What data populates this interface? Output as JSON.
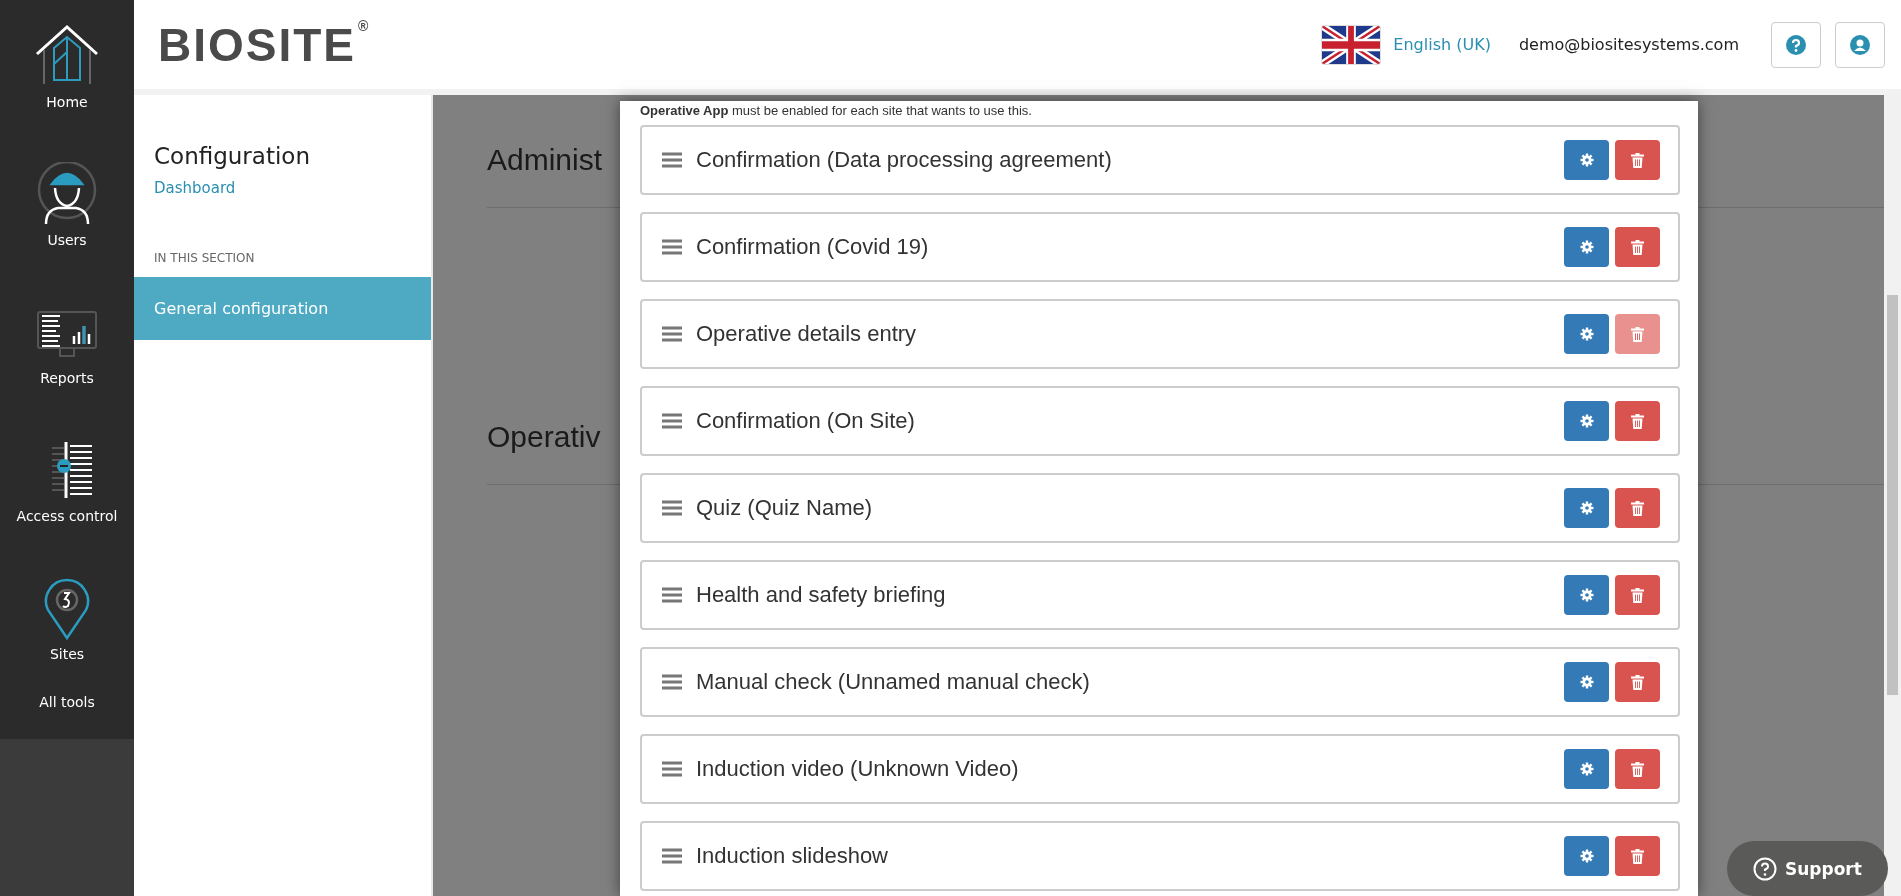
{
  "nav": {
    "items": [
      {
        "label": "Home"
      },
      {
        "label": "Users"
      },
      {
        "label": "Reports"
      },
      {
        "label": "Access control"
      },
      {
        "label": "Sites"
      }
    ],
    "all_tools": "All tools"
  },
  "header": {
    "logo": "BIOSITE",
    "logo_mark": "®",
    "language": "English (UK)",
    "email": "demo@biositesystems.com"
  },
  "sidebar": {
    "title": "Configuration",
    "link": "Dashboard",
    "section_label": "IN THIS SECTION",
    "items": [
      {
        "label": "General configuration",
        "selected": true
      }
    ]
  },
  "background": {
    "headings": [
      "Administ",
      "Operativ"
    ]
  },
  "modal": {
    "note": "**Operative App** must be enabled for each site that wants to use this.",
    "steps": [
      {
        "label": "Confirmation (Data processing agreement)",
        "delete_disabled": false
      },
      {
        "label": "Confirmation (Covid 19)",
        "delete_disabled": false
      },
      {
        "label": "Operative details entry",
        "delete_disabled": true
      },
      {
        "label": "Confirmation (On Site)",
        "delete_disabled": false
      },
      {
        "label": "Quiz (Quiz Name)",
        "delete_disabled": false
      },
      {
        "label": "Health and safety briefing",
        "delete_disabled": false
      },
      {
        "label": "Manual check (Unnamed manual check)",
        "delete_disabled": false
      },
      {
        "label": "Induction video (Unknown Video)",
        "delete_disabled": false
      },
      {
        "label": "Induction slideshow",
        "delete_disabled": false
      }
    ]
  },
  "support": "Support"
}
